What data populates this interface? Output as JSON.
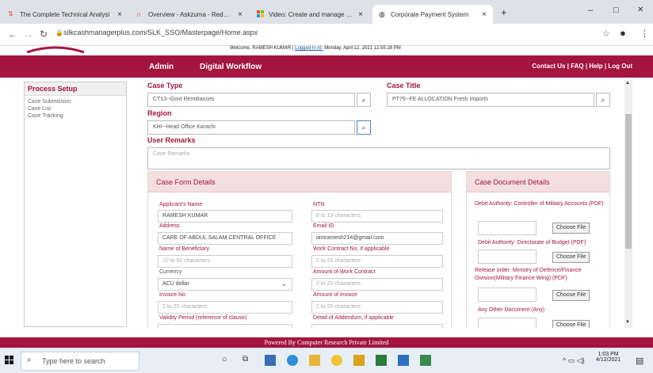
{
  "browser": {
    "tabs": [
      {
        "label": "The Complete Technical Analysi"
      },
      {
        "label": "Overview - Askzuma - Redmine"
      },
      {
        "label": "Video: Create and manage drop-"
      },
      {
        "label": "Corporate Payment System"
      }
    ],
    "url": "silkcashmanagerplus.com/SLK_SSO/Masterpage/Home.aspx",
    "new_tab": "+",
    "close_glyph": "×",
    "win_min": "–",
    "win_max": "□",
    "win_close": "✕"
  },
  "welcome": {
    "text": "Welcome, RAMESH KUMAR |",
    "logged": "Logged In At:",
    "time": "Monday, April 12, 2021 12:55:28 PM"
  },
  "menu": {
    "admin": "Admin",
    "workflow": "Digital Workflow",
    "right_links": "Contact Us | FAQ | Help | Log Out"
  },
  "sidebar": {
    "title": "Process Setup",
    "items": [
      {
        "label": "Case Submission"
      },
      {
        "label": "Case List"
      },
      {
        "label": "Case Tracking"
      }
    ]
  },
  "case": {
    "type_label": "Case Type",
    "type_value": "CT13--Govt Remittances",
    "title_label": "Case Title",
    "title_value": "PT76--FE ALLOCATION Fresh Imports",
    "region_label": "Region",
    "region_value": "KHI--Head Office Karachi",
    "remarks_label": "User Remarks",
    "remarks_placeholder": "Case Remarks"
  },
  "form": {
    "title": "Case Form Details",
    "fields": [
      {
        "label": "Applicant's Name",
        "value": "RAMESH KUMAR"
      },
      {
        "label": "NTN",
        "value": "8 to 13 characters"
      },
      {
        "label": "Address",
        "value": "CARE OF ABDUL SALAM CENTRAL OFFICE"
      },
      {
        "label": "Email ID",
        "value": "iamramesh214@gmail.com"
      },
      {
        "label": "Name of Beneficiary",
        "value": "10 to 50 characters"
      },
      {
        "label": "Work Contract No, if applicable",
        "value": "2 to 25 characters"
      },
      {
        "label": "Currency",
        "value": "ACU dollar"
      },
      {
        "label": "Amount of Work Contract",
        "value": "2 to 20 characters"
      },
      {
        "label": "Invoice No",
        "value": "2 to 25 characters"
      },
      {
        "label": "Amount of Invoice",
        "value": "2 to 20 characters"
      },
      {
        "label": "Validity Period (reference of clause)",
        "value": ""
      },
      {
        "label": "Detail of Addendum, if applicable",
        "value": ""
      }
    ]
  },
  "docs": {
    "title": "Case Document Details",
    "choose_label": "Choose File",
    "items": [
      {
        "label": "Debit Authority: Controller of Military Accounts (PDF)"
      },
      {
        "label": "Debit Authority: Directorate of Budget (PDF)"
      },
      {
        "label": "Release order: Ministry of Defence/Finance Division(Military Finance Wing) (PDF)"
      },
      {
        "label": "Any Other Document (Any)"
      }
    ]
  },
  "footer": "Powered By Computer Research Private Limited",
  "taskbar": {
    "search_placeholder": "Type here to search",
    "time": "1:03 PM",
    "date": "4/12/2021"
  },
  "colors": {
    "brand": "#a3153e"
  }
}
